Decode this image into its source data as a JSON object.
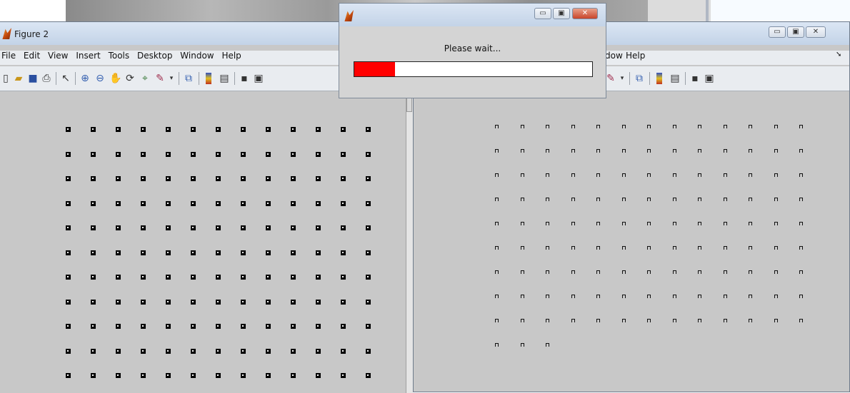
{
  "figure2": {
    "title": "Figure 2",
    "menu": [
      "File",
      "Edit",
      "View",
      "Insert",
      "Tools",
      "Desktop",
      "Window",
      "Help"
    ],
    "toolbar_icons": [
      "new-figure-icon",
      "open-file-icon",
      "save-icon",
      "print-icon",
      "pointer-icon",
      "zoom-in-icon",
      "zoom-out-icon",
      "pan-hand-icon",
      "rotate-3d-icon",
      "data-cursor-icon",
      "brush-icon",
      "dropdown-arrow-icon",
      "link-plot-icon",
      "colorbar-icon",
      "legend-icon",
      "hide-plot-tools-icon",
      "show-plot-tools-icon"
    ]
  },
  "figure_right": {
    "menu_partial": [
      "dow",
      "Help"
    ],
    "toolbar_icons": [
      "brush-icon",
      "dropdown-arrow-icon",
      "link-plot-icon",
      "colorbar-icon",
      "legend-icon",
      "hide-plot-tools-icon",
      "show-plot-tools-icon"
    ],
    "window_buttons": [
      "minimize",
      "maximize",
      "close"
    ]
  },
  "wait_dialog": {
    "message": "Please wait...",
    "progress_fraction": 0.17,
    "progress_color": "#ff0000",
    "window_buttons": [
      "minimize",
      "maximize",
      "close"
    ]
  },
  "colors": {
    "plot_background": "#c8c8c8",
    "marker": "#000000"
  }
}
